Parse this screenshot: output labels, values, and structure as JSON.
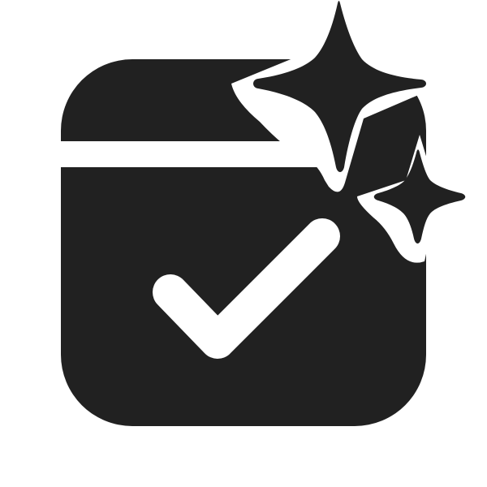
{
  "icon": {
    "name": "calendar-checkmark-sparkle-icon",
    "color": "#212121",
    "background": "#ffffff"
  }
}
